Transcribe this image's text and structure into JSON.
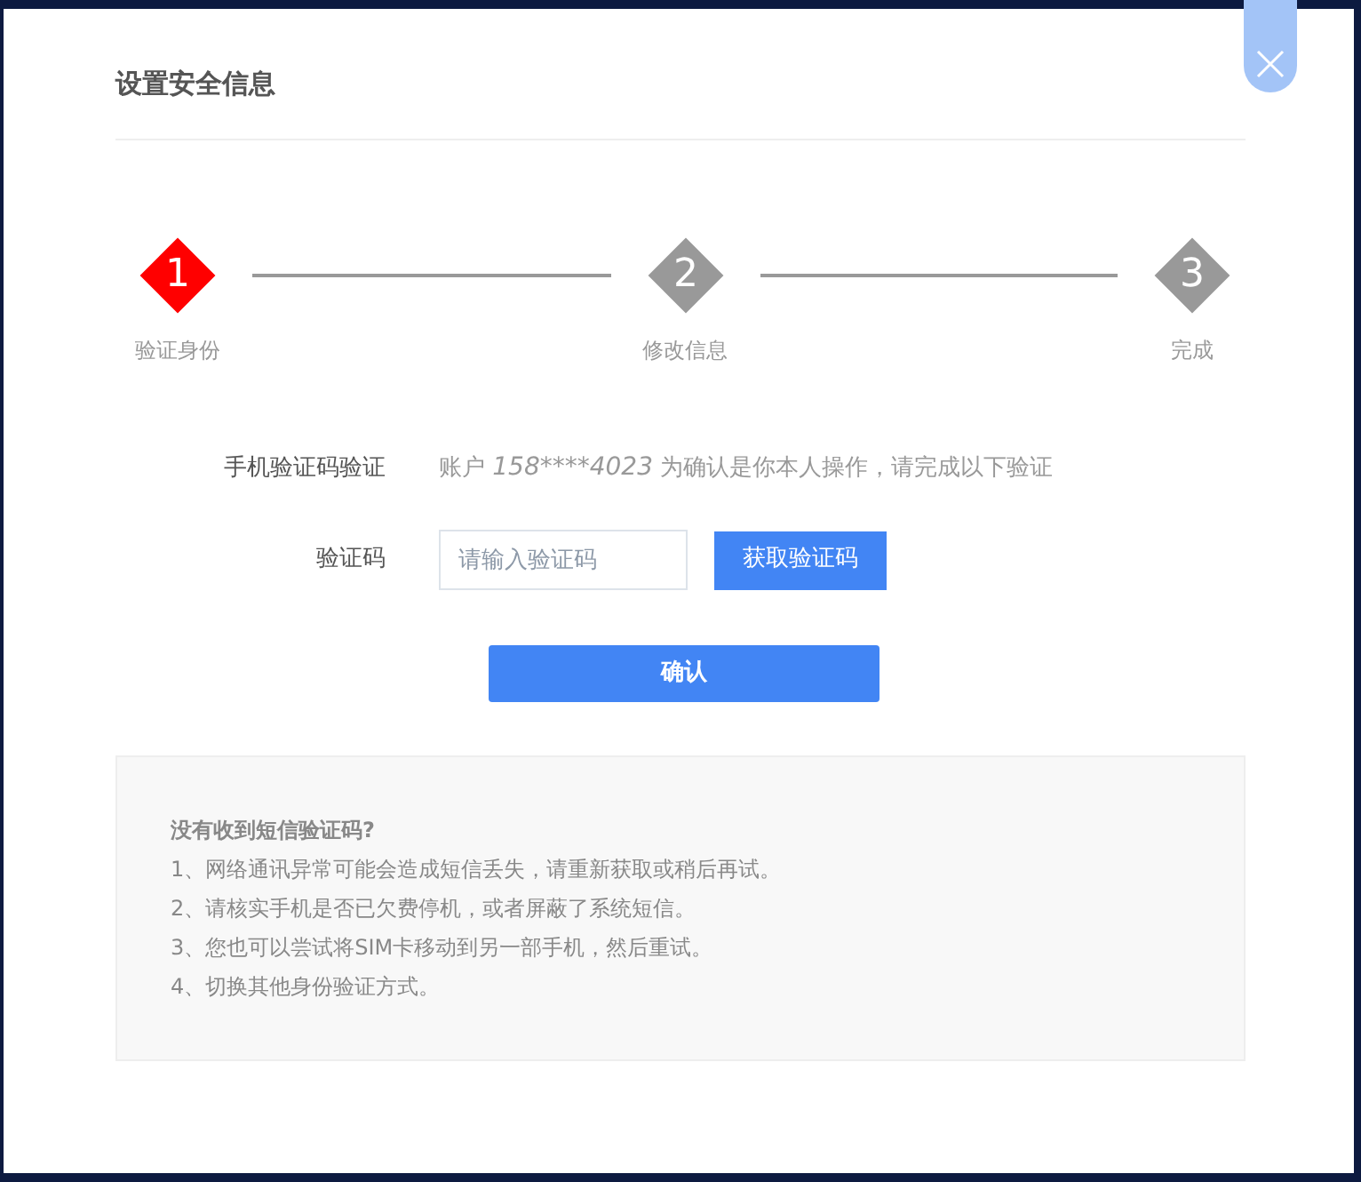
{
  "dialog": {
    "title": "设置安全信息"
  },
  "steps": [
    {
      "number": "1",
      "label": "验证身份",
      "selected": true
    },
    {
      "number": "2",
      "label": "修改信息",
      "selected": false
    },
    {
      "number": "3",
      "label": "完成",
      "selected": false
    }
  ],
  "form": {
    "method_label": "手机验证码验证",
    "method_prefix": "账户",
    "account": "158****4023",
    "method_suffix": "为确认是你本人操作，请完成以下验证",
    "code_label": "验证码",
    "code_placeholder": "请输入验证码",
    "send_button": "获取验证码",
    "confirm_button": "确认"
  },
  "help": {
    "title": "没有收到短信验证码?",
    "items": [
      "1、网络通讯异常可能会造成短信丢失，请重新获取或稍后再试。",
      "2、请核实手机是否已欠费停机，或者屏蔽了系统短信。",
      "3、您也可以尝试将SIM卡移动到另一部手机，然后重试。",
      "4、切换其他身份验证方式。"
    ]
  }
}
